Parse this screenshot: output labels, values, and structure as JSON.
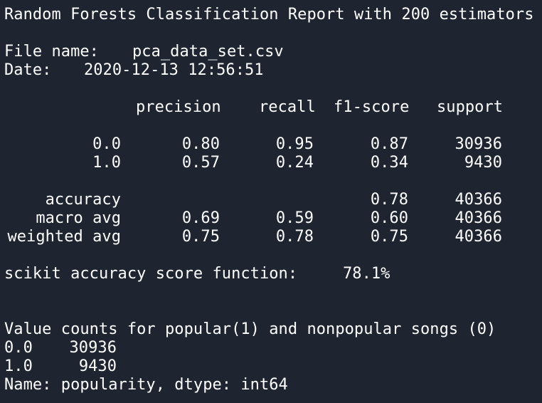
{
  "report": {
    "title": "Random Forests Classification Report with 200 estimators",
    "file_label": "File name:",
    "file_value": "pca_data_set.csv",
    "date_label": "Date:",
    "date_value": "2020-12-13 12:56:51",
    "headers": {
      "precision": "precision",
      "recall": "recall",
      "f1": "f1-score",
      "support": "support"
    },
    "rows": [
      {
        "label": "0.0",
        "precision": "0.80",
        "recall": "0.95",
        "f1": "0.87",
        "support": "30936"
      },
      {
        "label": "1.0",
        "precision": "0.57",
        "recall": "0.24",
        "f1": "0.34",
        "support": "9430"
      }
    ],
    "summary": [
      {
        "label": "accuracy",
        "precision": "",
        "recall": "",
        "f1": "0.78",
        "support": "40366"
      },
      {
        "label": "macro avg",
        "precision": "0.69",
        "recall": "0.59",
        "f1": "0.60",
        "support": "40366"
      },
      {
        "label": "weighted avg",
        "precision": "0.75",
        "recall": "0.78",
        "f1": "0.75",
        "support": "40366"
      }
    ],
    "score_label": "scikit accuracy score function:",
    "score_value": "78.1%"
  },
  "value_counts": {
    "title": "Value counts for popular(1) and nonpopular songs (0)",
    "rows": [
      {
        "key": "0.0",
        "count": "30936"
      },
      {
        "key": "1.0",
        "count": "9430"
      }
    ],
    "footer": "Name: popularity, dtype: int64"
  }
}
